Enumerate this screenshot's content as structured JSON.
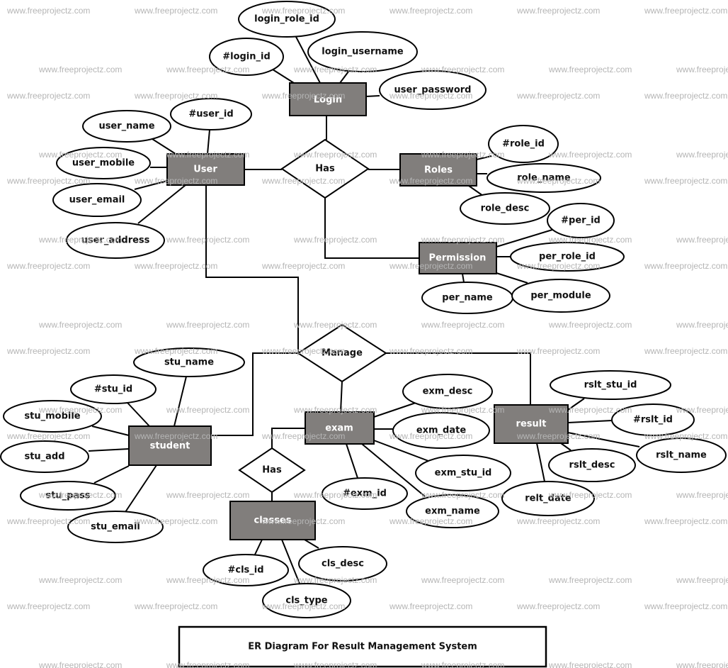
{
  "diagram": {
    "title": "ER Diagram For Result Management System",
    "watermark": "www.freeprojectz.com",
    "colors": {
      "entity_fill": "#817e7c",
      "entity_label": "#ffffff",
      "outline": "#000000",
      "attribute_fill": "#ffffff",
      "watermark": "#b5b5b5"
    },
    "entities": {
      "login": {
        "label": "Login",
        "attributes": [
          "login_role_id",
          "#login_id",
          "login_username",
          "user_password"
        ]
      },
      "user": {
        "label": "User",
        "attributes": [
          "#user_id",
          "user_name",
          "user_mobile",
          "user_email",
          "user_address"
        ]
      },
      "roles": {
        "label": "Roles",
        "attributes": [
          "#role_id",
          "role_name",
          "role_desc"
        ]
      },
      "permission": {
        "label": "Permission",
        "attributes": [
          "#per_id",
          "per_role_id",
          "per_name",
          "per_module"
        ]
      },
      "student": {
        "label": "student",
        "attributes": [
          "stu_name",
          "#stu_id",
          "stu_mobile",
          "stu_add",
          "stu_pass",
          "stu_email"
        ]
      },
      "exam": {
        "label": "exam",
        "attributes": [
          "exm_desc",
          "exm_date",
          "exm_stu_id",
          "#exm_id",
          "exm_name"
        ]
      },
      "result": {
        "label": "result",
        "attributes": [
          "rslt_stu_id",
          "#rslt_id",
          "rslt_name",
          "rslt_desc",
          "relt_date"
        ]
      },
      "classes": {
        "label": "classes",
        "attributes": [
          "#cls_id",
          "cls_desc",
          "cls_type"
        ]
      }
    },
    "relationships": {
      "has_user_roles": {
        "label": "Has",
        "connects": [
          "Login",
          "User",
          "Roles",
          "Permission"
        ]
      },
      "manage": {
        "label": "Manage",
        "connects": [
          "User",
          "student",
          "exam",
          "result"
        ]
      },
      "has_exam_classes": {
        "label": "Has",
        "connects": [
          "exam",
          "classes"
        ]
      }
    }
  }
}
